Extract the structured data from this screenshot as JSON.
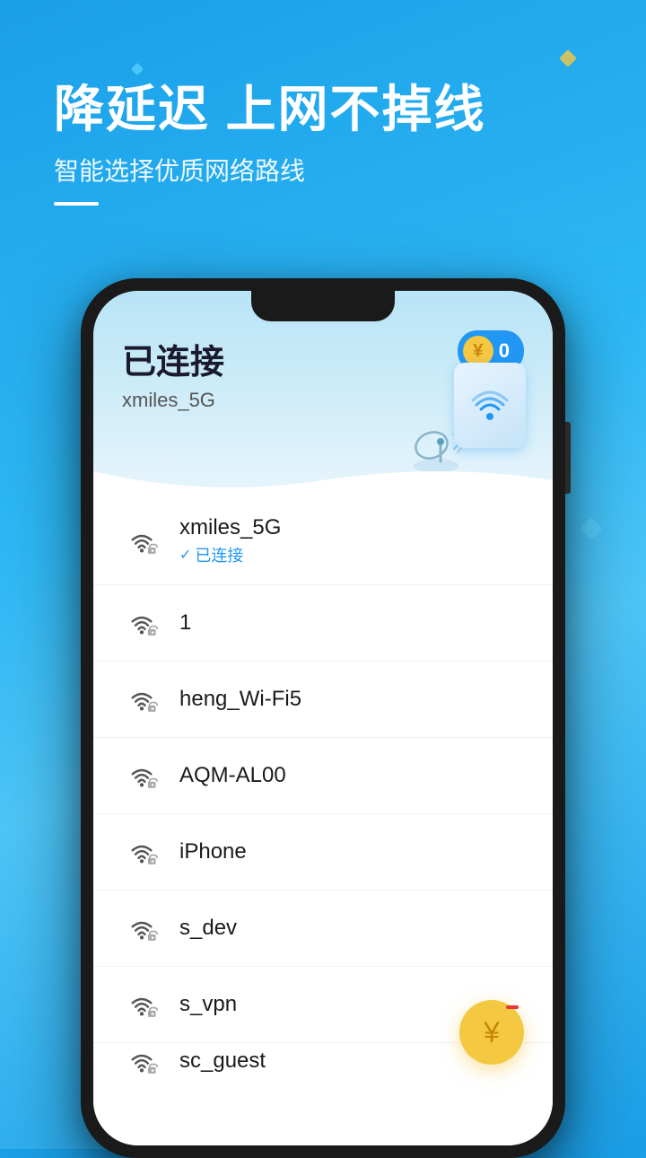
{
  "app": {
    "background_color": "#1a9fe8"
  },
  "header": {
    "title": "降延迟  上网不掉线",
    "subtitle": "智能选择优质网络路线"
  },
  "status": {
    "connected_label": "已连接",
    "network_name": "xmiles_5G"
  },
  "coin": {
    "count": "0",
    "icon_char": "¥"
  },
  "networks": [
    {
      "ssid": "xmiles_5G",
      "connected": true,
      "connected_text": "已连接",
      "locked": false
    },
    {
      "ssid": "1",
      "connected": false,
      "locked": true
    },
    {
      "ssid": "heng_Wi-Fi5",
      "connected": false,
      "locked": true
    },
    {
      "ssid": "AQM-AL00",
      "connected": false,
      "locked": true
    },
    {
      "ssid": "iPhone",
      "connected": false,
      "locked": true
    },
    {
      "ssid": "s_dev",
      "connected": false,
      "locked": true
    },
    {
      "ssid": "s_vpn",
      "connected": false,
      "locked": true
    },
    {
      "ssid": "sc_guest",
      "connected": false,
      "locked": true,
      "partial": true
    }
  ]
}
